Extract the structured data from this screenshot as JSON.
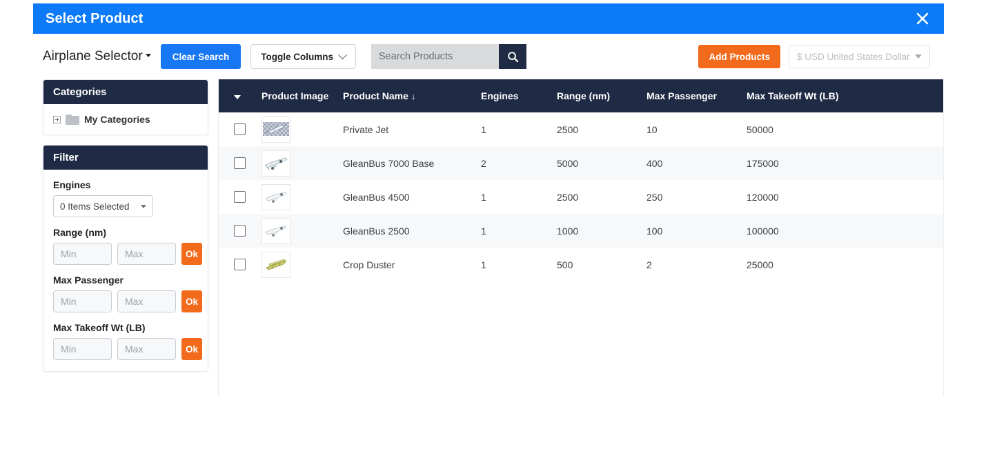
{
  "window": {
    "title": "Select Product",
    "close_icon": "close-icon"
  },
  "toolbar": {
    "selector_title": "Airplane Selector",
    "clear_search_label": "Clear Search",
    "toggle_columns_label": "Toggle Columns",
    "search_placeholder": "Search Products",
    "search_value": "",
    "search_icon": "search-icon",
    "add_products_label": "Add Products",
    "currency_value": "$ USD United States Dollar"
  },
  "sidebar": {
    "categories": {
      "title": "Categories",
      "root_label": "My Categories",
      "folder_icon": "folder-icon",
      "expand_icon": "plus-box-icon"
    },
    "filter": {
      "title": "Filter",
      "engines_label": "Engines",
      "engines_value": "0 Items Selected",
      "groups": [
        {
          "label": "Range (nm)",
          "min_placeholder": "Min",
          "max_placeholder": "Max",
          "min_value": "",
          "max_value": "",
          "ok_label": "Ok"
        },
        {
          "label": "Max Passenger",
          "min_placeholder": "Min",
          "max_placeholder": "Max",
          "min_value": "",
          "max_value": "",
          "ok_label": "Ok"
        },
        {
          "label": "Max Takeoff Wt (LB)",
          "min_placeholder": "Min",
          "max_placeholder": "Max",
          "min_value": "",
          "max_value": "",
          "ok_label": "Ok"
        }
      ]
    }
  },
  "table": {
    "columns": {
      "select_caret": "chevron-down-icon",
      "image": "Product Image",
      "name": "Product Name",
      "name_sort": "↓",
      "engines": "Engines",
      "range": "Range (nm)",
      "max_passenger": "Max Passenger",
      "max_takeoff": "Max Takeoff Wt (LB)"
    },
    "rows": [
      {
        "checked": false,
        "image": "private-jet-thumbnail",
        "name": "Private Jet",
        "engines": "1",
        "range": "2500",
        "max_passenger": "10",
        "max_takeoff": "50000"
      },
      {
        "checked": false,
        "image": "gleanbus-7000-base-thumbnail",
        "name": "GleanBus 7000 Base",
        "engines": "2",
        "range": "5000",
        "max_passenger": "400",
        "max_takeoff": "175000"
      },
      {
        "checked": false,
        "image": "gleanbus-4500-thumbnail",
        "name": "GleanBus 4500",
        "engines": "1",
        "range": "2500",
        "max_passenger": "250",
        "max_takeoff": "120000"
      },
      {
        "checked": false,
        "image": "gleanbus-2500-thumbnail",
        "name": "GleanBus 2500",
        "engines": "1",
        "range": "1000",
        "max_passenger": "100",
        "max_takeoff": "100000"
      },
      {
        "checked": false,
        "image": "crop-duster-thumbnail",
        "name": "Crop Duster",
        "engines": "1",
        "range": "500",
        "max_passenger": "2",
        "max_takeoff": "25000"
      }
    ]
  },
  "colors": {
    "title_bar_blue": "#0d7bf7",
    "primary_blue": "#1877f2",
    "dark_navy": "#1f2a44",
    "orange": "#f26a1b",
    "row_stripe": "#f7f8f9"
  }
}
